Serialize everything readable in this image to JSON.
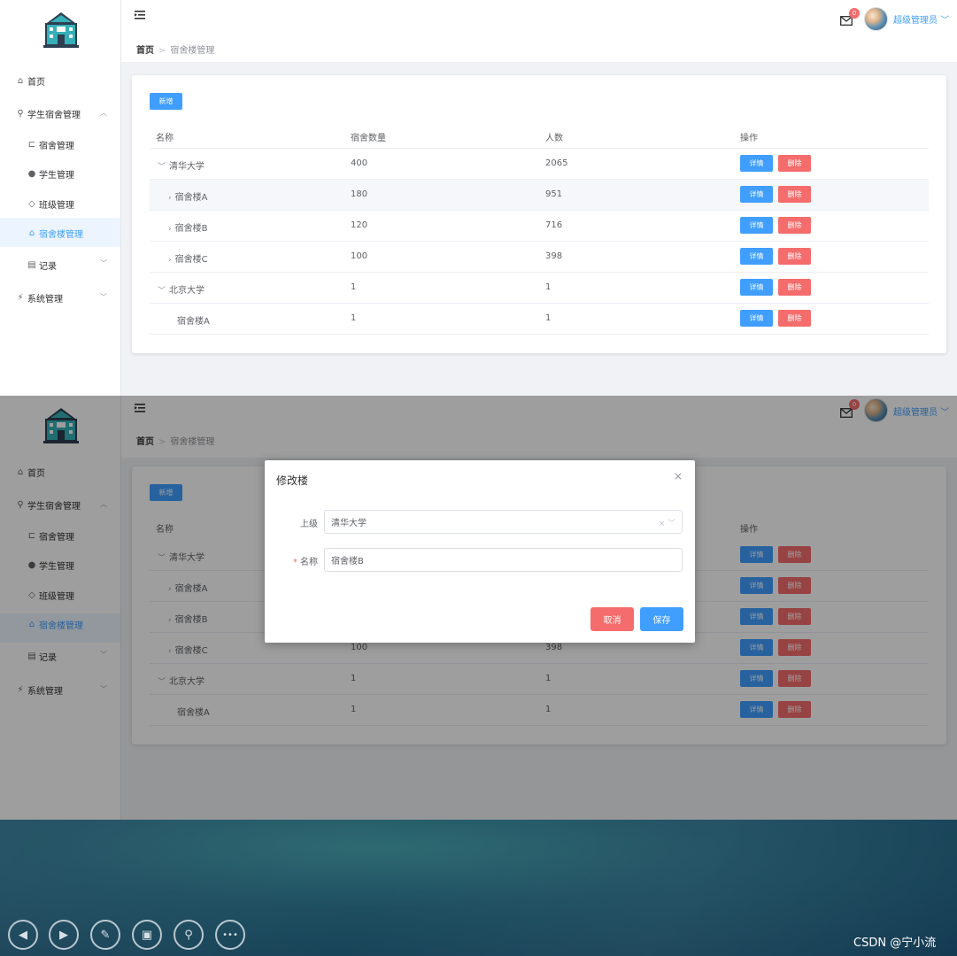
{
  "sidebar": {
    "items": [
      {
        "icon": "home-icon",
        "glyph": "⌂",
        "label": "首页"
      },
      {
        "icon": "paperclip-icon",
        "glyph": "⚲",
        "label": "学生宿舍管理"
      },
      {
        "icon": "crop-icon",
        "glyph": "⊏",
        "label": "宿舍管理"
      },
      {
        "icon": "user-icon",
        "glyph": "●",
        "label": "学生管理"
      },
      {
        "icon": "graduation-cap-icon",
        "glyph": "◇",
        "label": "班级管理"
      },
      {
        "icon": "house-icon",
        "glyph": "⌂",
        "label": "宿舍楼管理"
      },
      {
        "icon": "notebook-icon",
        "glyph": "▤",
        "label": "记录"
      },
      {
        "icon": "lightning-icon",
        "glyph": "⚡",
        "label": "系统管理"
      }
    ]
  },
  "header": {
    "breadcrumb_home": "首页",
    "breadcrumb_current": "宿舍楼管理",
    "badge_count": "0",
    "username": "超级管理员",
    "caret": "﹀"
  },
  "toolbar": {
    "add_label": "新增"
  },
  "table": {
    "headers": [
      "名称",
      "宿舍数量",
      "人数",
      "操作"
    ],
    "detail_label": "详情",
    "delete_label": "删除",
    "rows": [
      {
        "name": "清华大学",
        "rooms": "400",
        "people": "2065",
        "arrow": "﹀"
      },
      {
        "name": "宿舍楼A",
        "rooms": "180",
        "people": "951",
        "arrow": "›"
      },
      {
        "name": "宿舍楼B",
        "rooms": "120",
        "people": "716",
        "arrow": "›"
      },
      {
        "name": "宿舍楼C",
        "rooms": "100",
        "people": "398",
        "arrow": "›"
      },
      {
        "name": "北京大学",
        "rooms": "1",
        "people": "1",
        "arrow": "﹀"
      },
      {
        "name": "宿舍楼A",
        "rooms": "1",
        "people": "1",
        "arrow": ""
      }
    ]
  },
  "dialog": {
    "title": "修改楼",
    "close": "×",
    "parent_label": "上级",
    "parent_value": "清华大学",
    "name_required": "*",
    "name_label": "名称",
    "name_value": "宿舍楼B",
    "cancel_label": "取消",
    "save_label": "保存"
  },
  "player": {
    "controls": [
      {
        "name": "prev-slide-button",
        "icon": "prev-icon",
        "glyph": "◀"
      },
      {
        "name": "next-slide-button",
        "icon": "next-icon",
        "glyph": "▶"
      },
      {
        "name": "pen-button",
        "icon": "pen-icon",
        "glyph": "✎"
      },
      {
        "name": "slides-button",
        "icon": "slides-icon",
        "glyph": "▣"
      },
      {
        "name": "zoom-button",
        "icon": "magnifier-icon",
        "glyph": "⚲"
      },
      {
        "name": "more-button",
        "icon": "more-icon",
        "glyph": "•••"
      }
    ],
    "watermark": "CSDN @宁小流"
  },
  "colors": {
    "primary": "#409eff",
    "danger": "#f56c6c",
    "active_bg": "#ecf5ff"
  }
}
